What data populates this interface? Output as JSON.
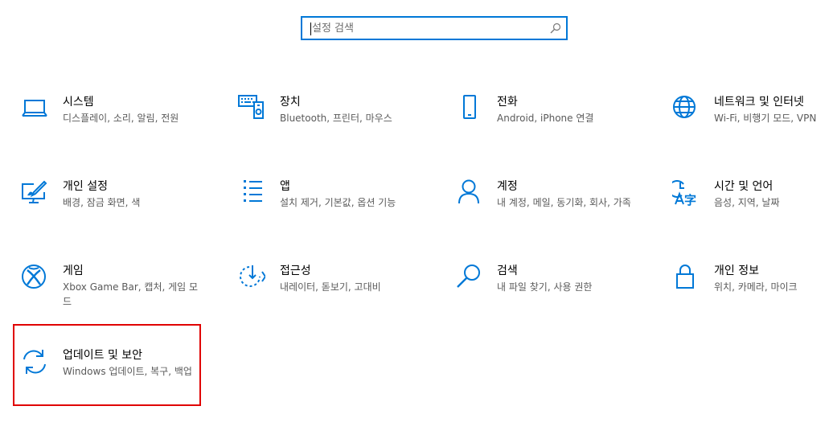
{
  "search": {
    "placeholder": "설정 검색"
  },
  "colors": {
    "accent": "#0078d7",
    "highlight_border": "#e00000"
  },
  "tiles": [
    {
      "title": "시스템",
      "desc": "디스플레이, 소리, 알림, 전원",
      "icon": "laptop-icon"
    },
    {
      "title": "장치",
      "desc": "Bluetooth, 프린터, 마우스",
      "icon": "keyboard-devices-icon"
    },
    {
      "title": "전화",
      "desc": "Android, iPhone 연결",
      "icon": "phone-icon"
    },
    {
      "title": "네트워크 및 인터넷",
      "desc": "Wi-Fi, 비행기 모드, VPN",
      "icon": "globe-icon"
    },
    {
      "title": "개인 설정",
      "desc": "배경, 잠금 화면, 색",
      "icon": "paint-screen-icon"
    },
    {
      "title": "앱",
      "desc": "설치 제거, 기본값, 옵션 기능",
      "icon": "apps-list-icon"
    },
    {
      "title": "계정",
      "desc": "내 계정, 메일, 동기화, 회사, 가족",
      "icon": "person-icon"
    },
    {
      "title": "시간 및 언어",
      "desc": "음성, 지역, 날짜",
      "icon": "time-language-icon"
    },
    {
      "title": "게임",
      "desc": "Xbox Game Bar, 캡처, 게임 모드",
      "icon": "xbox-icon"
    },
    {
      "title": "접근성",
      "desc": "내레이터, 돋보기, 고대비",
      "icon": "ease-of-access-icon"
    },
    {
      "title": "검색",
      "desc": "내 파일 찾기, 사용 권한",
      "icon": "search-icon"
    },
    {
      "title": "개인 정보",
      "desc": "위치, 카메라, 마이크",
      "icon": "lock-icon"
    },
    {
      "title": "업데이트 및 보안",
      "desc": "Windows 업데이트, 복구, 백업",
      "icon": "sync-arrows-icon"
    }
  ]
}
